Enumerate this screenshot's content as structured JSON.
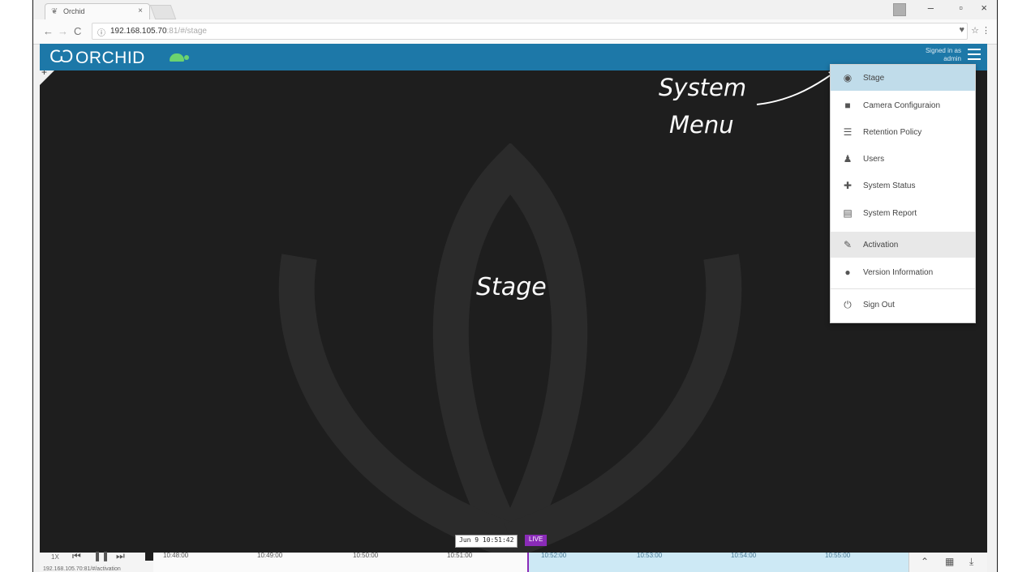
{
  "browser": {
    "tab_title": "Orchid",
    "url_main": "192.168.105.70",
    "url_rest": ":81/#/stage",
    "status_url": "192.168.105.70:81/#/activation"
  },
  "header": {
    "logo_text": "ORCHID",
    "signed_in": "Signed in as",
    "signed_user": "admin"
  },
  "stage": {
    "label": "Stage",
    "annotation_line1": "System",
    "annotation_line2": "Menu"
  },
  "menu": {
    "items": [
      {
        "label": "Stage",
        "icon": "eye-icon"
      },
      {
        "label": "Camera Configuraion",
        "icon": "video-camera-icon"
      },
      {
        "label": "Retention Policy",
        "icon": "database-icon"
      },
      {
        "label": "Users",
        "icon": "user-icon"
      },
      {
        "label": "System Status",
        "icon": "medkit-icon"
      },
      {
        "label": "System Report",
        "icon": "report-icon"
      },
      {
        "label": "Activation",
        "icon": "plug-icon"
      },
      {
        "label": "Version Information",
        "icon": "info-icon"
      },
      {
        "label": "Sign Out",
        "icon": "power-icon"
      }
    ]
  },
  "timeline": {
    "speed": "1X",
    "current_time": "Jun 9 10:51:42",
    "live_label": "LIVE",
    "ticks": [
      "10:48:00",
      "10:49:00",
      "10:50:00",
      "10:51:00",
      "10:52:00",
      "10:53:00",
      "10:54:00",
      "10:55:00"
    ]
  },
  "colors": {
    "header_bg": "#1d78a8",
    "stage_bg": "#1e1e1e",
    "active_menu": "#c0dcea",
    "live": "#8a2bb8",
    "future_track": "#cde9f5"
  }
}
